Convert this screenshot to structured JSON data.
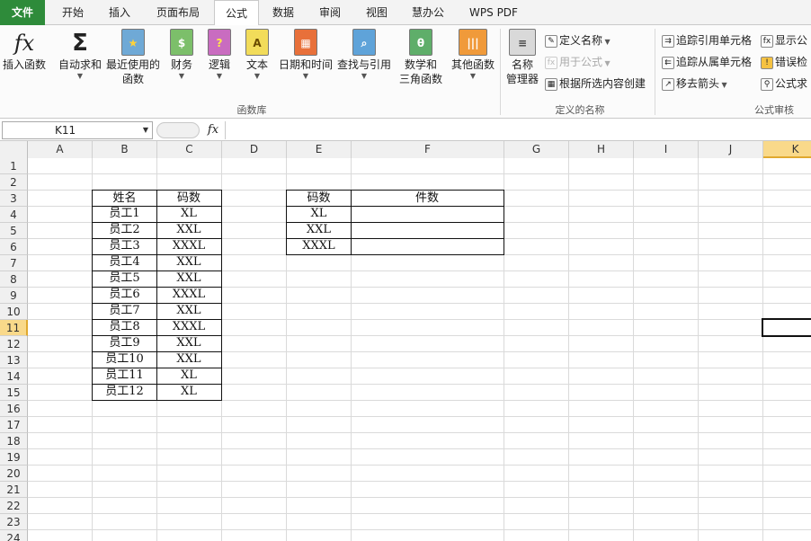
{
  "tabs": [
    "文件",
    "开始",
    "插入",
    "页面布局",
    "公式",
    "数据",
    "审阅",
    "视图",
    "慧办公",
    "WPS PDF"
  ],
  "active_tab": "公式",
  "ribbon": {
    "function_library": {
      "buttons": [
        {
          "label": "插入函数",
          "icon": "fx-icon"
        },
        {
          "label": "自动求和",
          "icon": "sigma-icon"
        },
        {
          "label": "最近使用的\n函数",
          "icon": "book-star-icon"
        },
        {
          "label": "财务",
          "icon": "book-finance-icon"
        },
        {
          "label": "逻辑",
          "icon": "book-question-icon"
        },
        {
          "label": "文本",
          "icon": "book-a-icon"
        },
        {
          "label": "日期和时间",
          "icon": "book-calendar-icon"
        },
        {
          "label": "查找与引用",
          "icon": "book-search-icon"
        },
        {
          "label": "数学和\n三角函数",
          "icon": "book-theta-icon"
        },
        {
          "label": "其他函数",
          "icon": "books-icon"
        }
      ],
      "group_label": "函数库"
    },
    "defined_names": {
      "manager_label": "名称\n管理器",
      "define_name": "定义名称",
      "use_in_formula": "用于公式",
      "create_from_selection": "根据所选内容创建",
      "group_label": "定义的名称"
    },
    "formula_auditing": {
      "trace_precedents": "追踪引用单元格",
      "trace_dependents": "追踪从属单元格",
      "remove_arrows": "移去箭头",
      "show_formulas": "显示公",
      "error_checking": "错误检",
      "evaluate": "公式求",
      "group_label": "公式审核"
    }
  },
  "formula_bar": {
    "name_box": "K11",
    "fx": "fx",
    "content": ""
  },
  "columns": [
    "A",
    "B",
    "C",
    "D",
    "E",
    "F",
    "G",
    "H",
    "I",
    "J",
    "K"
  ],
  "selected_column": "K",
  "rows": [
    "1",
    "2",
    "3",
    "4",
    "5",
    "6",
    "7",
    "8",
    "9",
    "10",
    "11",
    "12",
    "13",
    "14",
    "15",
    "16",
    "17",
    "18",
    "19",
    "20",
    "21",
    "22",
    "23",
    "24"
  ],
  "selected_row": "11",
  "table1": {
    "headers": [
      "姓名",
      "码数"
    ],
    "rows": [
      [
        "员工1",
        "XL"
      ],
      [
        "员工2",
        "XXL"
      ],
      [
        "员工3",
        "XXXL"
      ],
      [
        "员工4",
        "XXL"
      ],
      [
        "员工5",
        "XXL"
      ],
      [
        "员工6",
        "XXXL"
      ],
      [
        "员工7",
        "XXL"
      ],
      [
        "员工8",
        "XXXL"
      ],
      [
        "员工9",
        "XXL"
      ],
      [
        "员工10",
        "XXL"
      ],
      [
        "员工11",
        "XL"
      ],
      [
        "员工12",
        "XL"
      ]
    ]
  },
  "table2": {
    "headers": [
      "码数",
      "件数"
    ],
    "rows": [
      [
        "XL",
        ""
      ],
      [
        "XXL",
        ""
      ],
      [
        "XXXL",
        ""
      ]
    ]
  },
  "colors": {
    "file_tab": "#2e8b3a",
    "selected_header": "#f9d98a"
  }
}
